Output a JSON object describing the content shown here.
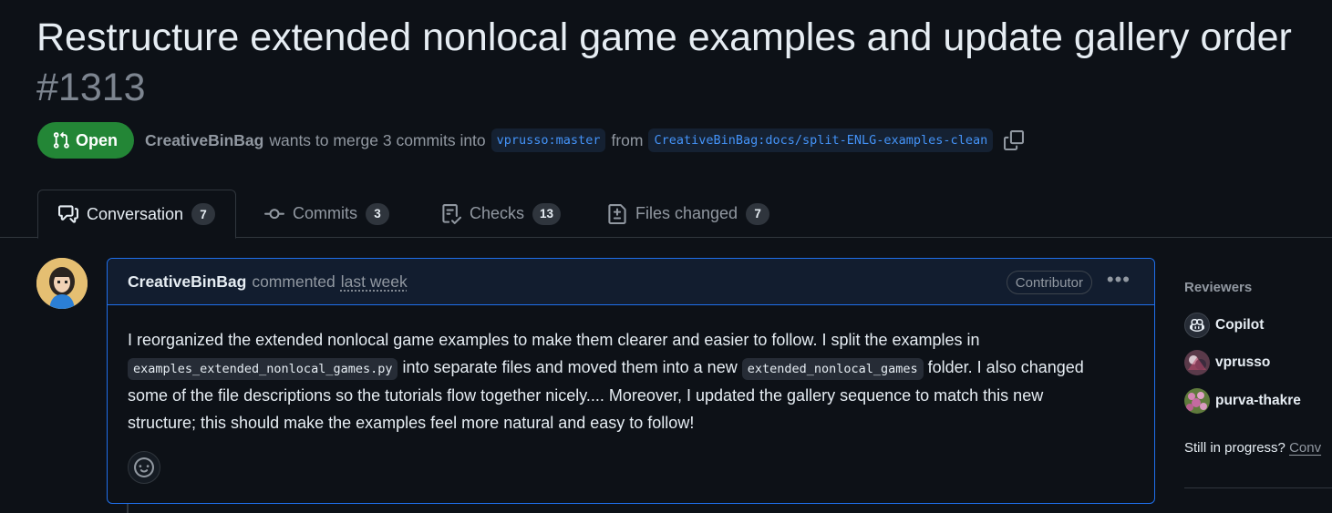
{
  "pr": {
    "title": "Restructure extended nonlocal game examples and update gallery order",
    "number": "#1313",
    "state": "Open",
    "author": "CreativeBinBag",
    "action_text": "wants to merge 3 commits into",
    "base_branch": "vprusso:master",
    "from_text": "from",
    "head_branch": "CreativeBinBag:docs/split-ENLG-examples-clean"
  },
  "tabs": [
    {
      "label": "Conversation",
      "count": "7",
      "icon": "comment-discussion-icon"
    },
    {
      "label": "Commits",
      "count": "3",
      "icon": "git-commit-icon"
    },
    {
      "label": "Checks",
      "count": "13",
      "icon": "checklist-icon"
    },
    {
      "label": "Files changed",
      "count": "7",
      "icon": "file-diff-icon"
    }
  ],
  "comment": {
    "author": "CreativeBinBag",
    "action": "commented",
    "time": "last week",
    "role": "Contributor",
    "body_1": "I reorganized the extended nonlocal game examples to make them clearer and easier to follow. I split the examples in ",
    "code_1": "examples_extended_nonlocal_games.py",
    "body_2": " into separate files and moved them into a new ",
    "code_2": "extended_nonlocal_games",
    "body_3": " folder. I also changed some of the file descriptions so the tutorials flow together nicely.... Moreover, I updated the gallery sequence to match this new structure; this should make the examples feel more natural and easy to follow!"
  },
  "sidebar": {
    "reviewers_heading": "Reviewers",
    "reviewers": [
      {
        "name": "Copilot",
        "icon": "copilot-icon"
      },
      {
        "name": "vprusso",
        "icon": "avatar"
      },
      {
        "name": "purva-thakre",
        "icon": "avatar"
      }
    ],
    "note_text": "Still in progress?",
    "note_link": "Conv"
  },
  "colors": {
    "open_badge": "#238636",
    "branch_text": "#4493f8",
    "comment_border": "#1f6feb",
    "background": "#0d1117"
  }
}
